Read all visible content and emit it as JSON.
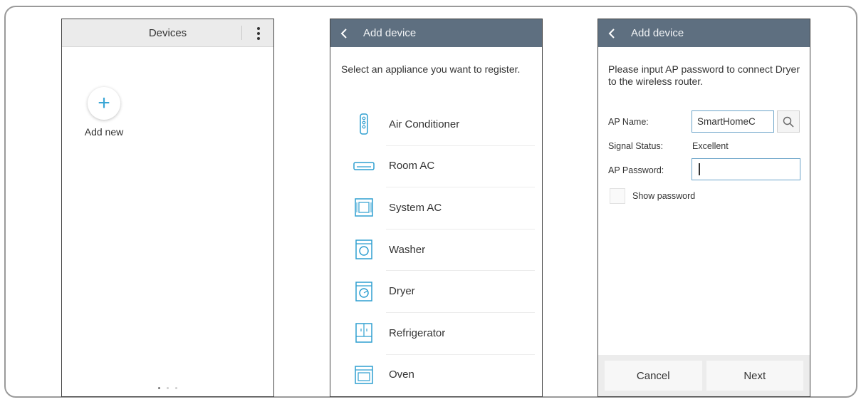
{
  "screen1": {
    "title": "Devices",
    "add_new_label": "Add new"
  },
  "screen2": {
    "title": "Add device",
    "intro": "Select an appliance you want to register.",
    "appliances": [
      {
        "label": "Air Conditioner",
        "icon": "air-conditioner-icon"
      },
      {
        "label": "Room AC",
        "icon": "room-ac-icon"
      },
      {
        "label": "System AC",
        "icon": "system-ac-icon"
      },
      {
        "label": "Washer",
        "icon": "washer-icon"
      },
      {
        "label": "Dryer",
        "icon": "dryer-icon"
      },
      {
        "label": "Refrigerator",
        "icon": "refrigerator-icon"
      },
      {
        "label": "Oven",
        "icon": "oven-icon"
      }
    ]
  },
  "screen3": {
    "title": "Add device",
    "intro": "Please input AP password to connect Dryer to the wireless router.",
    "ap_name_label": "AP Name:",
    "ap_name_value": "SmartHomeC",
    "signal_label": "Signal Status:",
    "signal_value": "Excellent",
    "ap_password_label": "AP Password:",
    "ap_password_value": "",
    "show_password_label": "Show password",
    "cancel_label": "Cancel",
    "next_label": "Next"
  },
  "colors": {
    "header_bar": "#5e6f80",
    "accent": "#3aa6d5",
    "input_border": "#6aa3c8"
  }
}
